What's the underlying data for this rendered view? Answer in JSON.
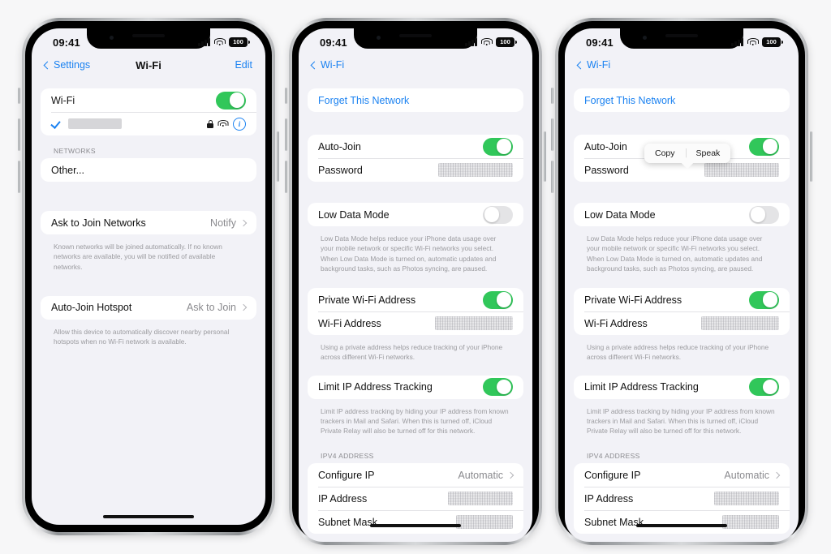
{
  "meta": {
    "accent_blue": "#1b82f1",
    "toggle_green": "#31c75a",
    "screen_bg": "#f2f2f7",
    "page_bg": "#f7f7f8"
  },
  "status_bar": {
    "time": "09:41",
    "battery_level": "100",
    "signal_icon": "cellular-bars-icon",
    "wifi_icon": "wifi-icon",
    "battery_icon": "battery-icon"
  },
  "phone1": {
    "nav": {
      "back_label": "Settings",
      "title": "Wi-Fi",
      "action_label": "Edit"
    },
    "wifi_group": {
      "wifi_label": "Wi-Fi",
      "wifi_on": true,
      "network": {
        "ssid_redacted": true,
        "connected_icon": "checkmark-icon",
        "lock_icon": "lock-icon",
        "signal_icon": "wifi-signal-icon",
        "info_icon": "info-circle-icon"
      }
    },
    "networks_section": {
      "header": "NETWORKS",
      "other_label": "Other..."
    },
    "ask_to_join": {
      "label": "Ask to Join Networks",
      "value": "Notify",
      "footnote": "Known networks will be joined automatically. If no known networks are available, you will be notified of available networks."
    },
    "auto_join_hotspot": {
      "label": "Auto-Join Hotspot",
      "value": "Ask to Join",
      "footnote": "Allow this device to automatically discover nearby personal hotspots when no Wi-Fi network is available."
    }
  },
  "phone2": {
    "nav": {
      "back_label": "Wi-Fi"
    },
    "forget_label": "Forget This Network",
    "auto_join": {
      "label": "Auto-Join",
      "on": true
    },
    "password": {
      "label": "Password",
      "value_redacted": true
    },
    "low_data_mode": {
      "label": "Low Data Mode",
      "on": false,
      "footnote": "Low Data Mode helps reduce your iPhone data usage over your mobile network or specific Wi-Fi networks you select. When Low Data Mode is turned on, automatic updates and background tasks, such as Photos syncing, are paused."
    },
    "private_wifi": {
      "label": "Private Wi-Fi Address",
      "on": true,
      "address_label": "Wi-Fi Address",
      "address_redacted": true,
      "footnote": "Using a private address helps reduce tracking of your iPhone across different Wi-Fi networks."
    },
    "limit_ip": {
      "label": "Limit IP Address Tracking",
      "on": true,
      "footnote": "Limit IP address tracking by hiding your IP address from known trackers in Mail and Safari. When this is turned off, iCloud Private Relay will also be turned off for this network."
    },
    "ipv4": {
      "header": "IPV4 ADDRESS",
      "configure_ip_label": "Configure IP",
      "configure_ip_value": "Automatic",
      "ip_address_label": "IP Address",
      "ip_address_redacted": true,
      "subnet_mask_label": "Subnet Mask",
      "subnet_mask_redacted": true
    }
  },
  "phone3": {
    "nav": {
      "back_label": "Wi-Fi"
    },
    "forget_label": "Forget This Network",
    "popup": {
      "copy_label": "Copy",
      "speak_label": "Speak"
    },
    "auto_join": {
      "label": "Auto-Join",
      "on": true
    },
    "password": {
      "label": "Password",
      "value_redacted": true
    },
    "low_data_mode": {
      "label": "Low Data Mode",
      "on": false,
      "footnote": "Low Data Mode helps reduce your iPhone data usage over your mobile network or specific Wi-Fi networks you select. When Low Data Mode is turned on, automatic updates and background tasks, such as Photos syncing, are paused."
    },
    "private_wifi": {
      "label": "Private Wi-Fi Address",
      "on": true,
      "address_label": "Wi-Fi Address",
      "address_redacted": true,
      "footnote": "Using a private address helps reduce tracking of your iPhone across different Wi-Fi networks."
    },
    "limit_ip": {
      "label": "Limit IP Address Tracking",
      "on": true,
      "footnote": "Limit IP address tracking by hiding your IP address from known trackers in Mail and Safari. When this is turned off, iCloud Private Relay will also be turned off for this network."
    },
    "ipv4": {
      "header": "IPV4 ADDRESS",
      "configure_ip_label": "Configure IP",
      "configure_ip_value": "Automatic",
      "ip_address_label": "IP Address",
      "ip_address_redacted": true,
      "subnet_mask_label": "Subnet Mask",
      "subnet_mask_redacted": true
    }
  }
}
